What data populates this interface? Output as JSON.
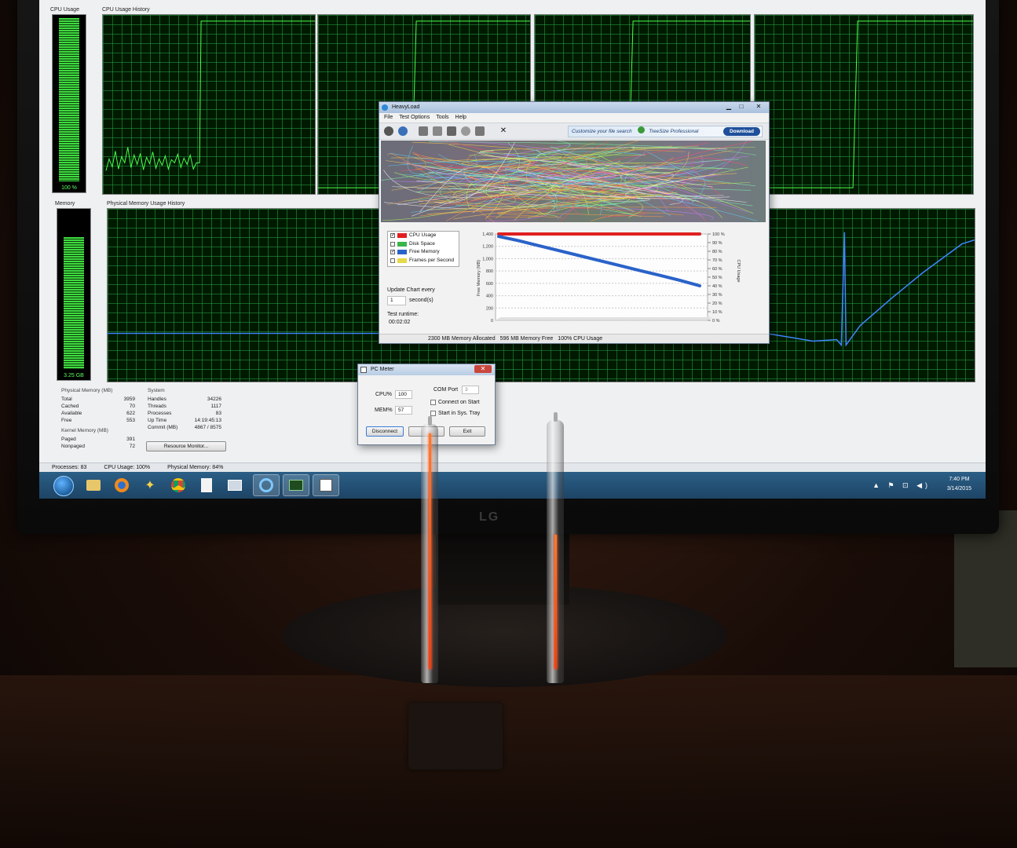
{
  "task_manager": {
    "cpu_usage_label": "CPU Usage",
    "cpu_history_label": "CPU Usage History",
    "cpu_value": "100 %",
    "cpu_fraction": 1.0,
    "memory_label": "Memory",
    "memory_history_label": "Physical Memory Usage History",
    "memory_value": "3.25 GB",
    "memory_fraction": 0.84,
    "physical_memory": {
      "header": "Physical Memory (MB)",
      "rows": [
        {
          "label": "Total",
          "value": "3959"
        },
        {
          "label": "Cached",
          "value": "70"
        },
        {
          "label": "Available",
          "value": "622"
        },
        {
          "label": "Free",
          "value": "553"
        }
      ]
    },
    "kernel_memory": {
      "header": "Kernel Memory (MB)",
      "rows": [
        {
          "label": "Paged",
          "value": "391"
        },
        {
          "label": "Nonpaged",
          "value": "72"
        }
      ]
    },
    "system": {
      "header": "System",
      "rows": [
        {
          "label": "Handles",
          "value": "34226"
        },
        {
          "label": "Threads",
          "value": "1117"
        },
        {
          "label": "Processes",
          "value": "83"
        },
        {
          "label": "Up Time",
          "value": "14:19:45:13"
        },
        {
          "label": "Commit (MB)",
          "value": "4867 / 8575"
        }
      ]
    },
    "resource_monitor_label": "Resource Monitor...",
    "status": {
      "processes": "Processes: 83",
      "cpu": "CPU Usage: 100%",
      "memory": "Physical Memory: 84%"
    }
  },
  "heavyload": {
    "title": "HeavyLoad",
    "menu": [
      "File",
      "Test Options",
      "Tools",
      "Help"
    ],
    "ad_text": "Customize your file search",
    "ad_product": "TreeSize Professional",
    "ad_button": "Download",
    "legend": [
      {
        "label": "CPU Usage",
        "checked": "✓",
        "color": "#e02020"
      },
      {
        "label": "Disk Space",
        "checked": "",
        "color": "#39b54a"
      },
      {
        "label": "Free Memory",
        "checked": "✓",
        "color": "#2a62c9"
      },
      {
        "label": "Frames per Second",
        "checked": "",
        "color": "#e6d94a"
      }
    ],
    "update_label": "Update Chart every",
    "update_value": "1",
    "update_unit": "second(s)",
    "runtime_label": "Test runtime:",
    "runtime_value": "00:02:02",
    "status": [
      "2300 MB Memory Allocated",
      "596 MB Memory Free",
      "100% CPU Usage"
    ],
    "chart_data": {
      "type": "line",
      "ylabel": "Free Memory (MB)",
      "y2label": "CPU Usage",
      "y_ticks": [
        "0",
        "200",
        "400",
        "600",
        "800",
        "1,000",
        "1,200",
        "1,400"
      ],
      "y2_ticks": [
        "0 %",
        "10 %",
        "20 %",
        "30 %",
        "40 %",
        "50 %",
        "60 %",
        "70 %",
        "80 %",
        "90 %",
        "100 %"
      ],
      "ylim": [
        0,
        1400
      ],
      "y2lim": [
        0,
        100
      ],
      "series": [
        {
          "name": "CPU Usage",
          "color": "#e02020",
          "axis": "right",
          "values": [
            100,
            100,
            100,
            100,
            100,
            100,
            100,
            100,
            100,
            100,
            100
          ]
        },
        {
          "name": "Free Memory",
          "color": "#2a62c9",
          "axis": "left",
          "values": [
            1360,
            1290,
            1210,
            1130,
            1050,
            970,
            890,
            810,
            730,
            650,
            560
          ]
        }
      ]
    }
  },
  "pc_meter": {
    "title": "PC Meter",
    "cpu_label": "CPU%",
    "cpu_value": "100",
    "mem_label": "MEM%",
    "mem_value": "57",
    "com_label": "COM Port",
    "com_value": "3",
    "connect_on_start": "Connect on Start",
    "start_in_tray": "Start in Sys. Tray",
    "disconnect": "Disconnect",
    "exit": "Exit"
  },
  "taskbar": {
    "time": "7:40 PM",
    "date": "3/14/2015"
  },
  "monitor_brand": "LG",
  "nixie": {
    "cpu_fraction": 1.0,
    "mem_fraction": 0.57
  }
}
